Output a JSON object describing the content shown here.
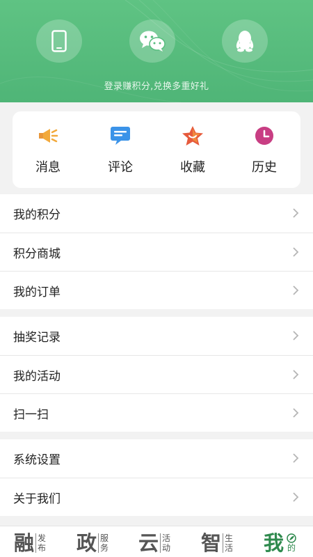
{
  "header": {
    "login_hint": "登录赚积分,兑换多重好礼",
    "login_buttons": [
      {
        "name": "phone-login-button",
        "icon": "phone-icon"
      },
      {
        "name": "wechat-login-button",
        "icon": "wechat-icon"
      },
      {
        "name": "qq-login-button",
        "icon": "qq-icon"
      }
    ],
    "colors": {
      "start": "#5fc383",
      "end": "#4fb577"
    }
  },
  "quick": [
    {
      "label": "消息",
      "icon": "megaphone-icon",
      "color": "#f2a93b"
    },
    {
      "label": "评论",
      "icon": "comment-icon",
      "color": "#3b93e8"
    },
    {
      "label": "收藏",
      "icon": "star-icon",
      "color": "#e65a3c"
    },
    {
      "label": "历史",
      "icon": "clock-icon",
      "color": "#d2417c"
    }
  ],
  "groups": [
    {
      "items": [
        "我的积分",
        "积分商城",
        "我的订单"
      ]
    },
    {
      "items": [
        "抽奖记录",
        "我的活动",
        "扫一扫"
      ]
    },
    {
      "items": [
        "系统设置",
        "关于我们"
      ]
    }
  ],
  "tabbar": [
    {
      "big": "融",
      "sub": "发布",
      "active": false
    },
    {
      "big": "政",
      "sub": "服务",
      "active": false
    },
    {
      "big": "云",
      "sub": "活动",
      "active": false
    },
    {
      "big": "智",
      "sub": "生活",
      "active": false
    },
    {
      "big": "我",
      "sub": "的",
      "active": true
    }
  ],
  "accent": "#2f8a4e"
}
